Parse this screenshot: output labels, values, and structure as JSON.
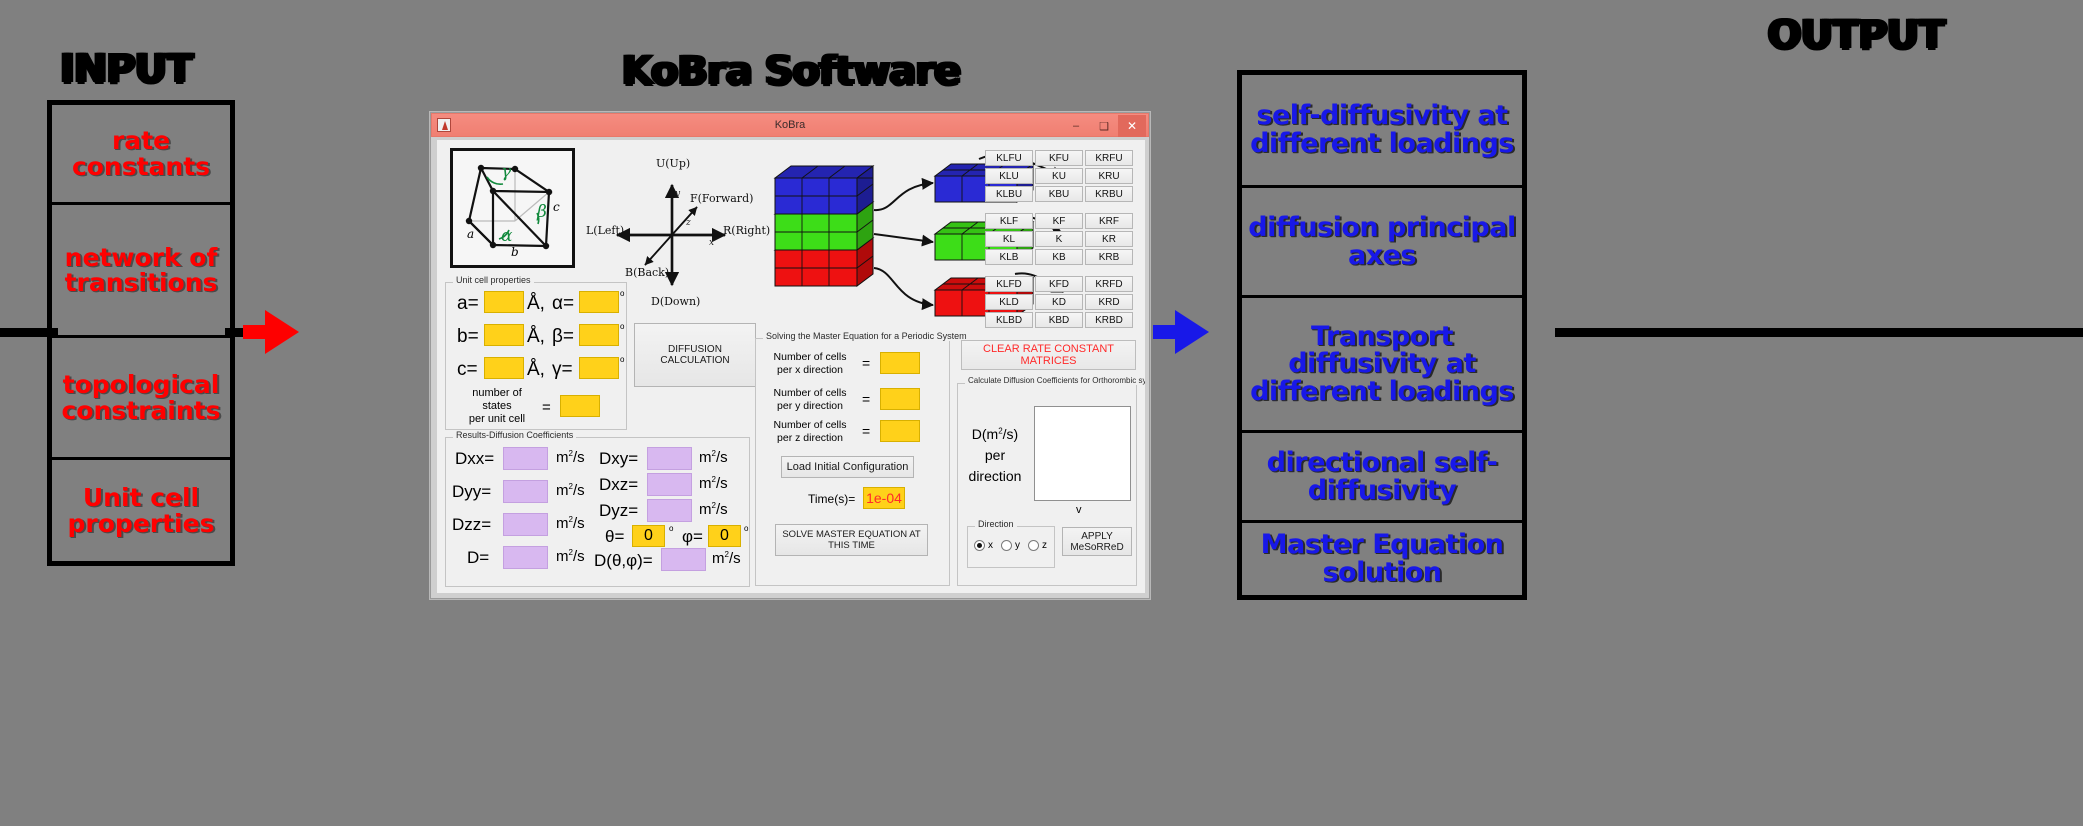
{
  "diagram": {
    "input_title": "INPUT",
    "center_title": "KoBra Software",
    "output_title": "OUTPUT",
    "input_items": [
      "rate constants",
      "network of transitions",
      "topological constraints",
      "Unit cell properties"
    ],
    "output_items": [
      "self-diffusivity at different loadings",
      "diffusion principal axes",
      "Transport diffusivity  at different loadings",
      "directional self-diffusivity",
      "Master Equation solution"
    ],
    "input_color": "#ff0000",
    "output_color": "#1818e8",
    "arrow_in_color": "#fe0000",
    "arrow_out_color": "#1818e8"
  },
  "window": {
    "title": "KoBra",
    "minimize": "–",
    "maximize": "❑",
    "close": "✕",
    "accent": "#f07f72"
  },
  "crystal": {
    "a": "a",
    "b": "b",
    "c": "c",
    "alpha": "α",
    "beta": "β",
    "gamma": "γ",
    "angle_color": "#128a3d"
  },
  "axes": {
    "up": "U(Up)",
    "down": "D(Down)",
    "left": "L(Left)",
    "right": "R(Right)",
    "forward": "F(Forward)",
    "back": "B(Back)",
    "x": "x",
    "y": "y",
    "z": "z"
  },
  "cubes": {
    "top_color": "#2a2ad4",
    "mid_color": "#3ddd18",
    "bot_color": "#ee1111"
  },
  "rate_matrices": [
    {
      "name": "upper-layer",
      "rows": [
        [
          "KLFU",
          "KFU",
          "KRFU"
        ],
        [
          "KLU",
          "KU",
          "KRU"
        ],
        [
          "KLBU",
          "KBU",
          "KRBU"
        ]
      ]
    },
    {
      "name": "middle-layer",
      "rows": [
        [
          "KLF",
          "KF",
          "KRF"
        ],
        [
          "KL",
          "K",
          "KR"
        ],
        [
          "KLB",
          "KB",
          "KRB"
        ]
      ]
    },
    {
      "name": "lower-layer",
      "rows": [
        [
          "KLFD",
          "KFD",
          "KRFD"
        ],
        [
          "KLD",
          "KD",
          "KRD"
        ],
        [
          "KLBD",
          "KBD",
          "KRBD"
        ]
      ]
    }
  ],
  "unit_cell": {
    "group_title": "Unit cell properties",
    "a_label": "a=",
    "a_value": "",
    "b_label": "b=",
    "b_value": "",
    "c_label": "c=",
    "c_value": "",
    "alpha_label": "α=",
    "alpha_value": "",
    "beta_label": "β=",
    "beta_value": "",
    "gamma_label": "γ=",
    "gamma_value": "",
    "angstrom": "Å,",
    "degree": "o",
    "states_label": "number of\nstates\nper unit cell",
    "states_line1": "number of",
    "states_line2": "states",
    "states_line3": "per unit cell",
    "states_eq": "=",
    "states_value": ""
  },
  "diffusion_button": {
    "label": "DIFFUSION CALCULATION"
  },
  "results": {
    "group_title": "Results-Diffusion Coefficients",
    "unit": "m²/s",
    "degree": "o",
    "rows_left": [
      {
        "label": "Dxx=",
        "value": ""
      },
      {
        "label": "Dyy=",
        "value": ""
      },
      {
        "label": "Dzz=",
        "value": ""
      },
      {
        "label": "D=",
        "value": ""
      }
    ],
    "rows_right": [
      {
        "label": "Dxy=",
        "value": ""
      },
      {
        "label": "Dxz=",
        "value": ""
      },
      {
        "label": "Dyz=",
        "value": ""
      }
    ],
    "theta_label": "θ=",
    "theta_value": "0",
    "phi_label": "φ=",
    "phi_value": "0",
    "dthetaphi_label": "D(θ,φ)=",
    "dthetaphi_value": ""
  },
  "master": {
    "group_title": "Solving the Master Equation for a Periodic System",
    "cells_x_l1": "Number of cells",
    "cells_x_l2": "per x direction",
    "cells_x_value": "",
    "cells_y_l1": "Number of cells",
    "cells_y_l2": "per y direction",
    "cells_y_value": "",
    "cells_z_l1": "Number of cells",
    "cells_z_l2": "per z direction",
    "cells_z_value": "",
    "equals": "=",
    "load_button": "Load Initial Configuration",
    "time_label": "Time(s)=",
    "time_value": "1e-04",
    "time_color": "#ff2a2a",
    "solve_button": "SOLVE MASTER EQUATION AT THIS TIME"
  },
  "mesorred": {
    "clear_button": "CLEAR RATE CONSTANT MATRICES",
    "group_title": "Calculate Diffusion Coefficients for Orthorombic systems using MESoRReD",
    "d_label_l1": "D(m²/s)",
    "d_label_l2": "per",
    "d_label_l3": "direction",
    "list_value": "",
    "scroll_glyph": "v",
    "direction_title": "Direction",
    "directions": [
      {
        "label": "x",
        "selected": true
      },
      {
        "label": "y",
        "selected": false
      },
      {
        "label": "z",
        "selected": false
      }
    ],
    "apply_button": "APPLY MeSoRReD"
  }
}
